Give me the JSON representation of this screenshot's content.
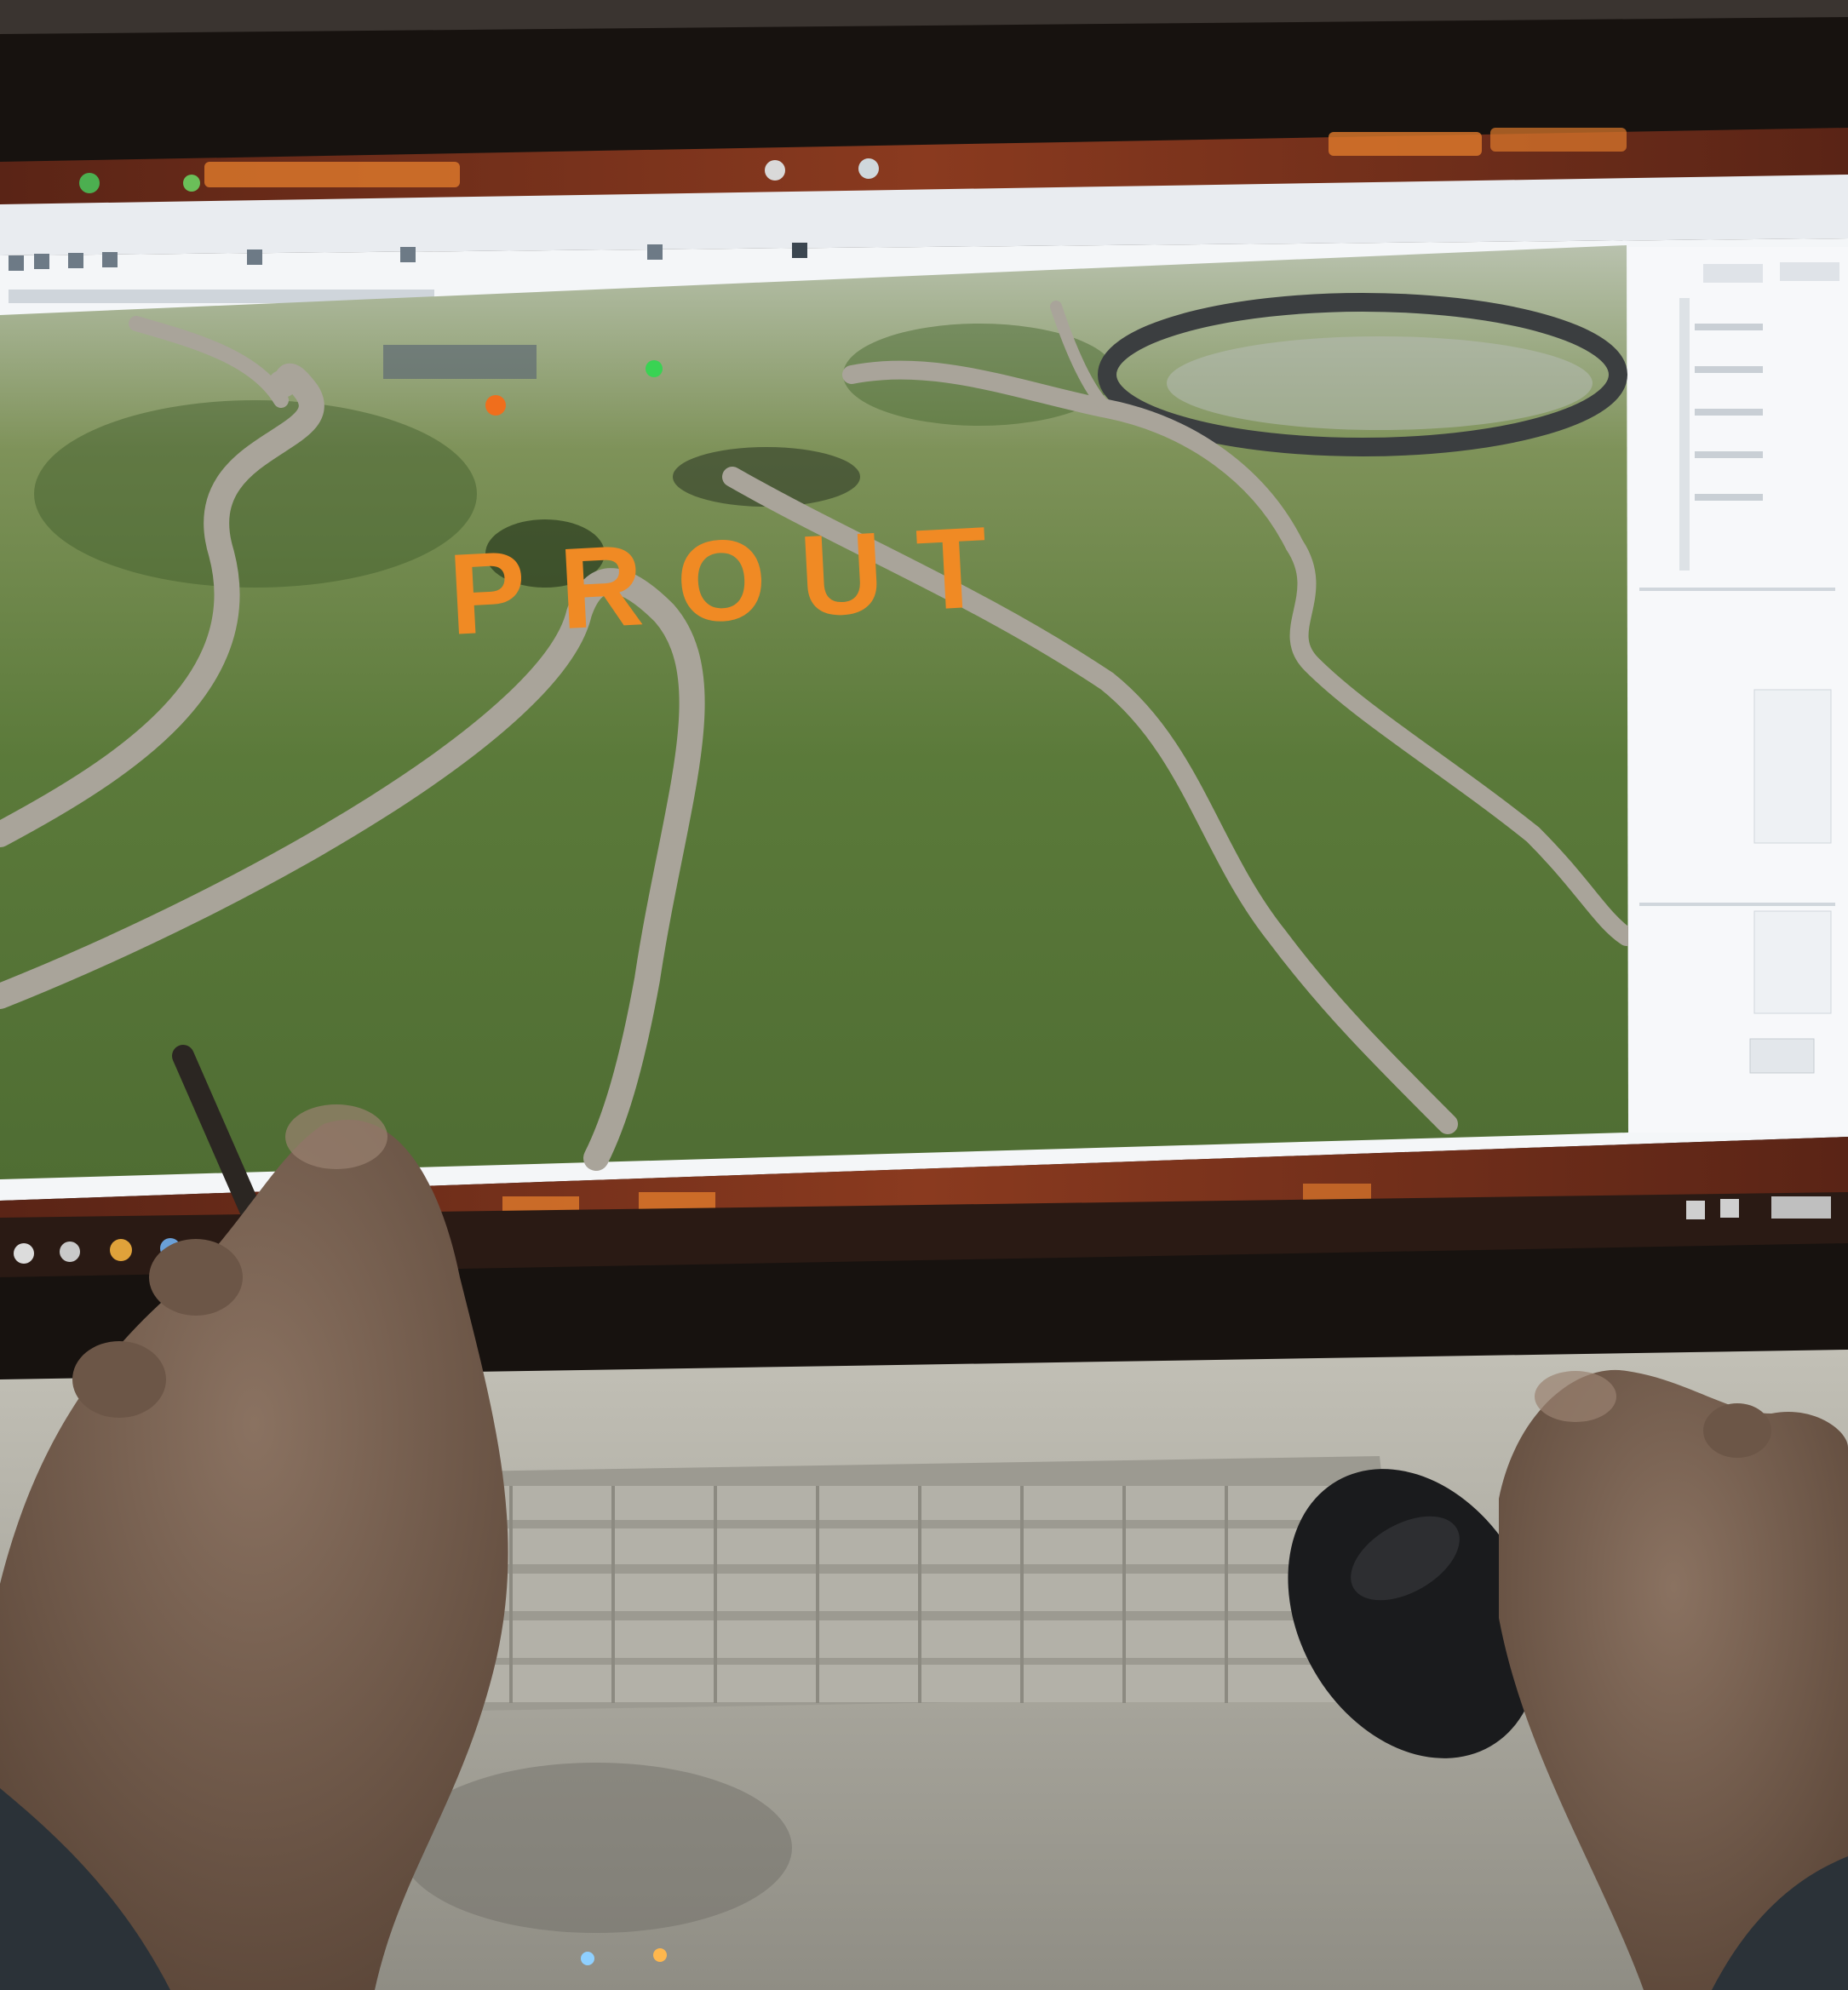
{
  "viewport": {
    "overlay_text": "PROUT",
    "overlay_color": "#f08a24",
    "terrain_color": "#5b7a3a",
    "road_color": "#a9a49a",
    "sky_color": "#b9c2ae"
  },
  "colors": {
    "screen_frame": "#17120f",
    "desktop_wallpaper": "#7a2f1c",
    "window_chrome": "#e9ecf0",
    "panel_bg": "#f4f6f8",
    "laptop_body": "#b8b6ac",
    "keys": "#a5a39a",
    "skin": "#7d6555",
    "mouse": "#1a1b1d"
  },
  "icons": {
    "taskbar": [
      "start-icon",
      "explorer-icon",
      "chrome-icon",
      "app-icon"
    ],
    "tray": [
      "network-icon",
      "volume-icon",
      "clock-icon"
    ],
    "toolbar": [
      "select-icon",
      "move-icon",
      "rotate-icon",
      "scale-icon",
      "play-icon"
    ]
  }
}
